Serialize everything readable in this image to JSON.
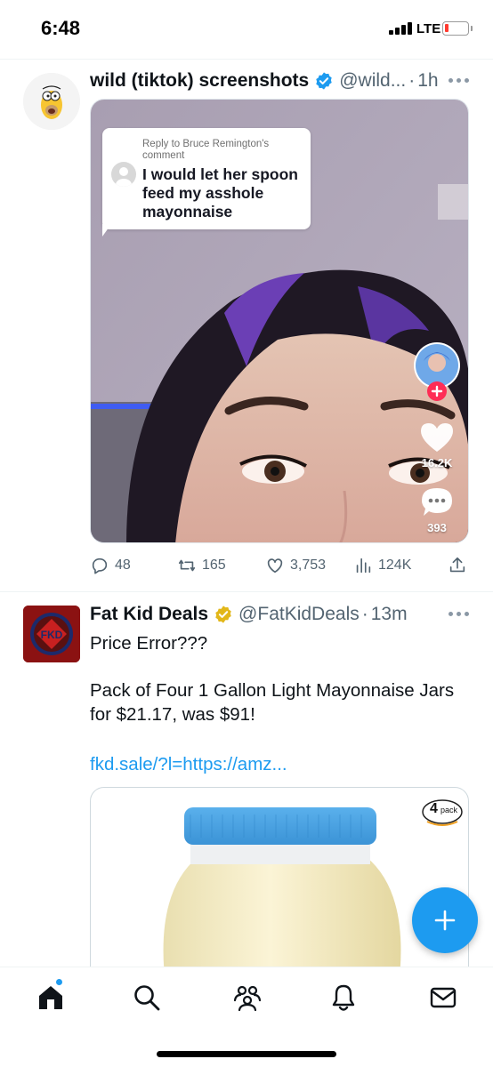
{
  "status_bar": {
    "time": "6:48",
    "network": "LTE",
    "signal_icon": "signal-bars-icon",
    "battery_icon": "battery-low-icon",
    "battery_color": "#ff3b30"
  },
  "colors": {
    "accent": "#1d9bf0",
    "verified_blue": "#1d9bf0",
    "verified_gold": "#e2b719",
    "secondary_text": "#536471",
    "tiktok_red": "#fe2c55"
  },
  "feed": {
    "tweets": [
      {
        "display_name": "wild (tiktok) screenshots",
        "verified": "blue",
        "handle": "@wild...",
        "separator": "·",
        "time": "1h",
        "avatar_icon": "cartoon-avatar-icon",
        "media": {
          "reply_header": "Reply to Bruce Remington's comment",
          "reply_text": "I would let her spoon feed my asshole mayonnaise",
          "like_count": "16.2K",
          "comment_count": "393",
          "follow_icon": "plus-icon"
        },
        "stats": {
          "replies": "48",
          "retweets": "165",
          "likes": "3,753",
          "views": "124K"
        }
      },
      {
        "display_name": "Fat Kid Deals",
        "verified": "gold",
        "handle": "@FatKidDeals",
        "separator": "·",
        "time": "13m",
        "avatar_icon": "fkd-logo-icon",
        "text_line1": "Price Error???",
        "text_line2": "Pack of Four 1 Gallon  Light Mayonnaise Jars for $21.17, was $91!",
        "link": "fkd.sale/?l=https://amz...",
        "card": {
          "badge_number": "4",
          "badge_word": "pack"
        }
      }
    ]
  },
  "fab": {
    "icon": "plus-icon"
  },
  "tabbar": {
    "items": [
      "home-icon",
      "search-icon",
      "communities-icon",
      "notifications-icon",
      "messages-icon"
    ]
  }
}
